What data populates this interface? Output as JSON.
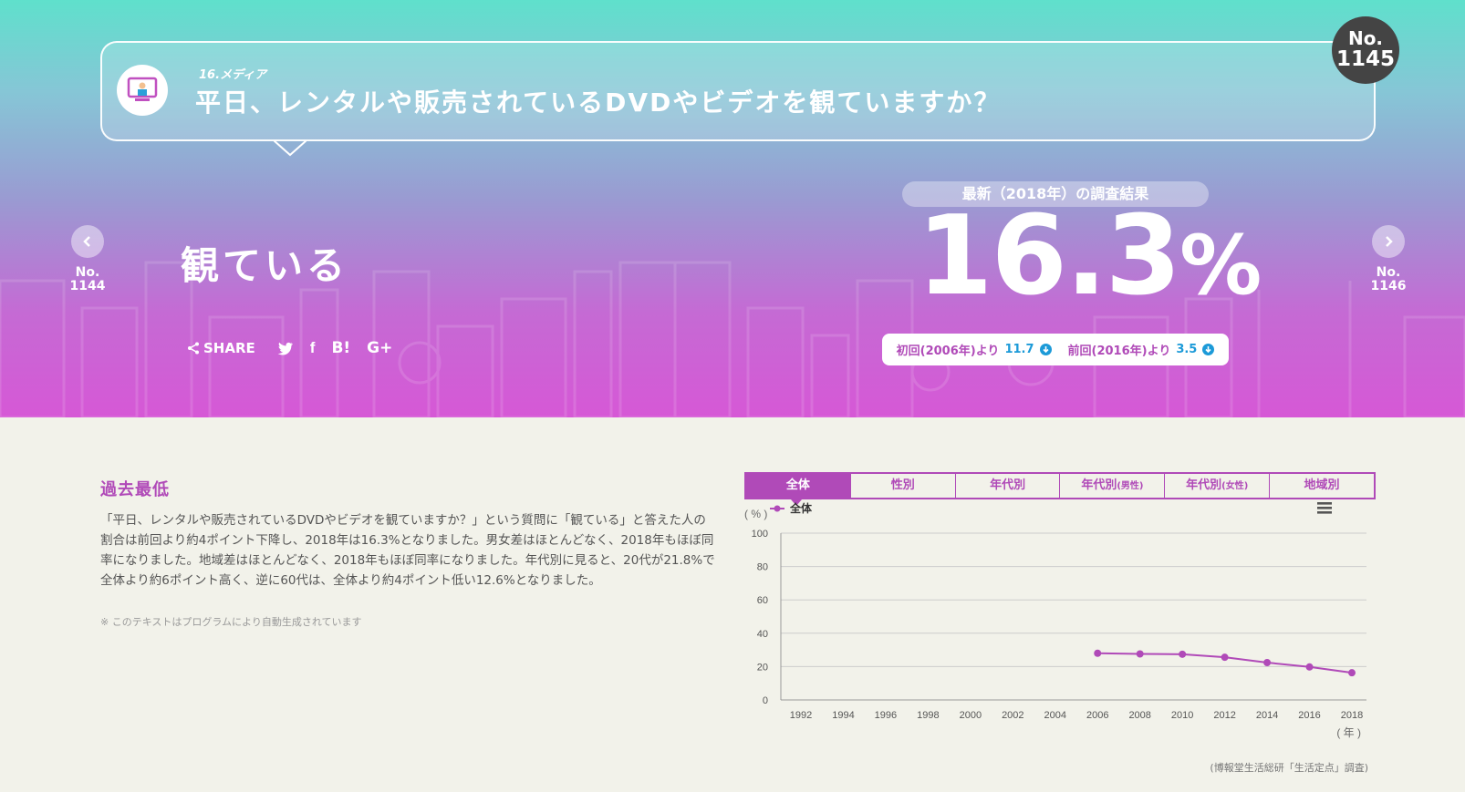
{
  "question": {
    "category": "16.メディア",
    "text": "平日、レンタルや販売されているDVDやビデオを観ていますか？",
    "number_prefix": "No.",
    "number": "1145"
  },
  "nav": {
    "prev_prefix": "No.",
    "prev_number": "1144",
    "next_prefix": "No.",
    "next_number": "1146"
  },
  "answer": "観ている",
  "share": {
    "label": "SHARE",
    "icons": [
      "twitter-icon",
      "facebook-icon",
      "hatena-bookmark-icon",
      "google-plus-icon"
    ],
    "hatena_text": "B!",
    "gplus_text": "G+",
    "facebook_text": "f"
  },
  "result": {
    "pill": "最新（2018年）の調査結果",
    "value": "16.3",
    "unit": "%",
    "first_label": "初回(2006年)より",
    "first_diff": "11.7",
    "prev_label": "前回(2016年)より",
    "prev_diff": "3.5"
  },
  "summary": {
    "heading": "過去最低",
    "text": "「平日、レンタルや販売されているDVDやビデオを観ていますか？」という質問に「観ている」と答えた人の割合は前回より約4ポイント下降し、2018年は16.3%となりました。男女差はほとんどなく、2018年もほぼ同率になりました。地域差はほとんどなく、2018年もほぼ同率になりました。年代別に見ると、20代が21.8%で全体より約6ポイント高く、逆に60代は、全体より約4ポイント低い12.6%となりました。",
    "note": "※ このテキストはプログラムにより自動生成されています"
  },
  "tabs": [
    {
      "label": "全体",
      "sub": "",
      "active": true
    },
    {
      "label": "性別",
      "sub": "",
      "active": false
    },
    {
      "label": "年代別",
      "sub": "",
      "active": false
    },
    {
      "label": "年代別",
      "sub": "(男性)",
      "active": false
    },
    {
      "label": "年代別",
      "sub": "(女性)",
      "active": false
    },
    {
      "label": "地域別",
      "sub": "",
      "active": false
    }
  ],
  "chart_data": {
    "type": "line",
    "ylabel": "( % )",
    "xlabel": "( 年 )",
    "ylim": [
      0,
      100
    ],
    "yticks": [
      0,
      20,
      40,
      60,
      80,
      100
    ],
    "xticks": [
      "1992",
      "1994",
      "1996",
      "1998",
      "2000",
      "2002",
      "2004",
      "2006",
      "2008",
      "2010",
      "2012",
      "2014",
      "2016",
      "2018"
    ],
    "grid": true,
    "legend": "top-left",
    "series": [
      {
        "name": "全体",
        "color": "#b04ab8",
        "x": [
          "2006",
          "2008",
          "2010",
          "2012",
          "2014",
          "2016",
          "2018"
        ],
        "values": [
          28.0,
          27.6,
          27.4,
          25.6,
          22.4,
          19.8,
          16.3
        ]
      }
    ],
    "source": "(博報堂生活総研「生活定点」調査)"
  },
  "colors": {
    "accent": "#b04ab8",
    "down": "#1c9ad8",
    "background": "#f2f2ea"
  }
}
